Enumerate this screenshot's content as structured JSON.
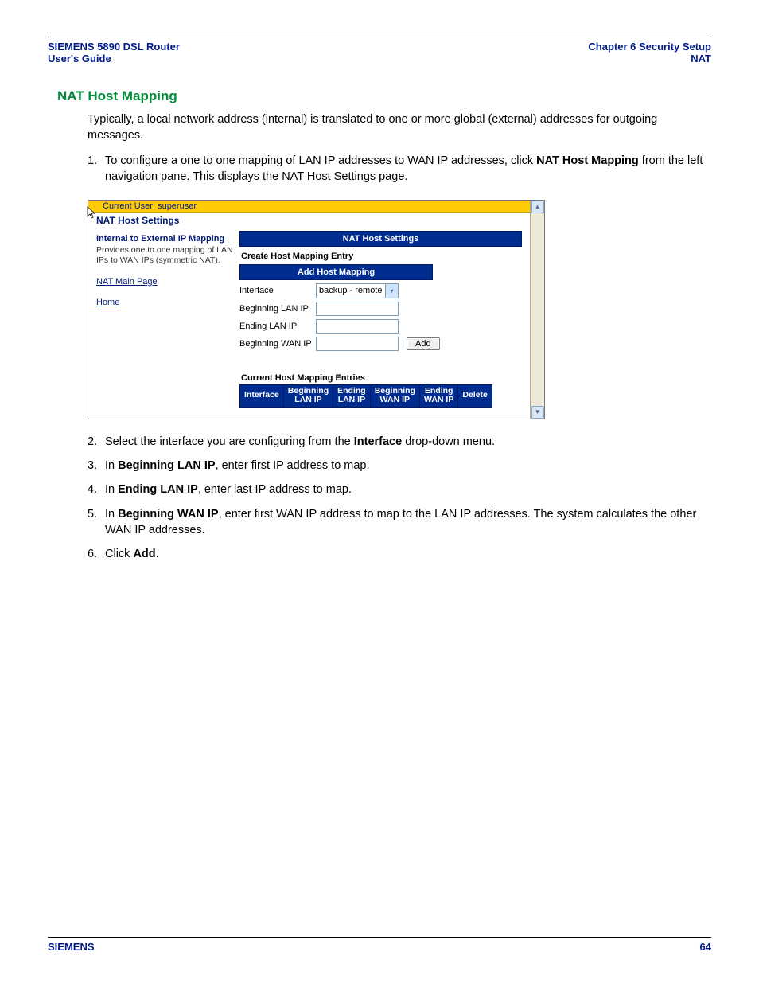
{
  "header": {
    "left_line1": "SIEMENS 5890 DSL Router",
    "left_line2": "User's Guide",
    "right_line1": "Chapter 6  Security Setup",
    "right_line2": "NAT"
  },
  "section_title": "NAT Host Mapping",
  "intro": "Typically, a local network address (internal) is translated to one or more global (external) addresses for outgoing messages.",
  "steps": {
    "s1_pre": "To configure a one to one mapping of LAN IP addresses to WAN IP addresses, click ",
    "s1_bold": "NAT Host Mapping",
    "s1_post": " from the left navigation pane. This displays the NAT Host Settings page.",
    "s2_pre": "Select the interface you are configuring from the ",
    "s2_bold": "Interface",
    "s2_post": " drop-down menu.",
    "s3_pre": "In ",
    "s3_bold": "Beginning LAN IP",
    "s3_post": ", enter first IP address to map.",
    "s4_pre": "In ",
    "s4_bold": "Ending LAN IP",
    "s4_post": ", enter last IP address to map.",
    "s5_pre": "In ",
    "s5_bold": "Beginning WAN IP",
    "s5_post": ", enter first WAN IP address to map to the LAN IP addresses. The system calculates the other WAN IP addresses.",
    "s6_pre": "Click ",
    "s6_bold": "Add",
    "s6_post": "."
  },
  "screenshot": {
    "current_user": "Current User: superuser",
    "page_title": "NAT Host Settings",
    "left_bold": "Internal to External IP Mapping",
    "left_desc": "Provides one to one mapping of LAN IPs to WAN IPs (symmetric NAT).",
    "nav_main": "NAT Main Page",
    "nav_home": "Home",
    "bar_title": "NAT Host Settings",
    "create_entry": "Create Host Mapping Entry",
    "add_bar": "Add Host Mapping",
    "f_interface": "Interface",
    "f_interface_val": "backup - remote",
    "f_blan": "Beginning LAN IP",
    "f_elan": "Ending LAN IP",
    "f_bwan": "Beginning WAN IP",
    "btn_add": "Add",
    "entries_title": "Current Host Mapping Entries",
    "th_interface": "Interface",
    "th_blan1": "Beginning",
    "th_blan2": "LAN IP",
    "th_elan1": "Ending",
    "th_elan2": "LAN IP",
    "th_bwan1": "Beginning",
    "th_bwan2": "WAN IP",
    "th_ewan1": "Ending",
    "th_ewan2": "WAN IP",
    "th_delete": "Delete"
  },
  "footer": {
    "brand": "SIEMENS",
    "page": "64"
  }
}
